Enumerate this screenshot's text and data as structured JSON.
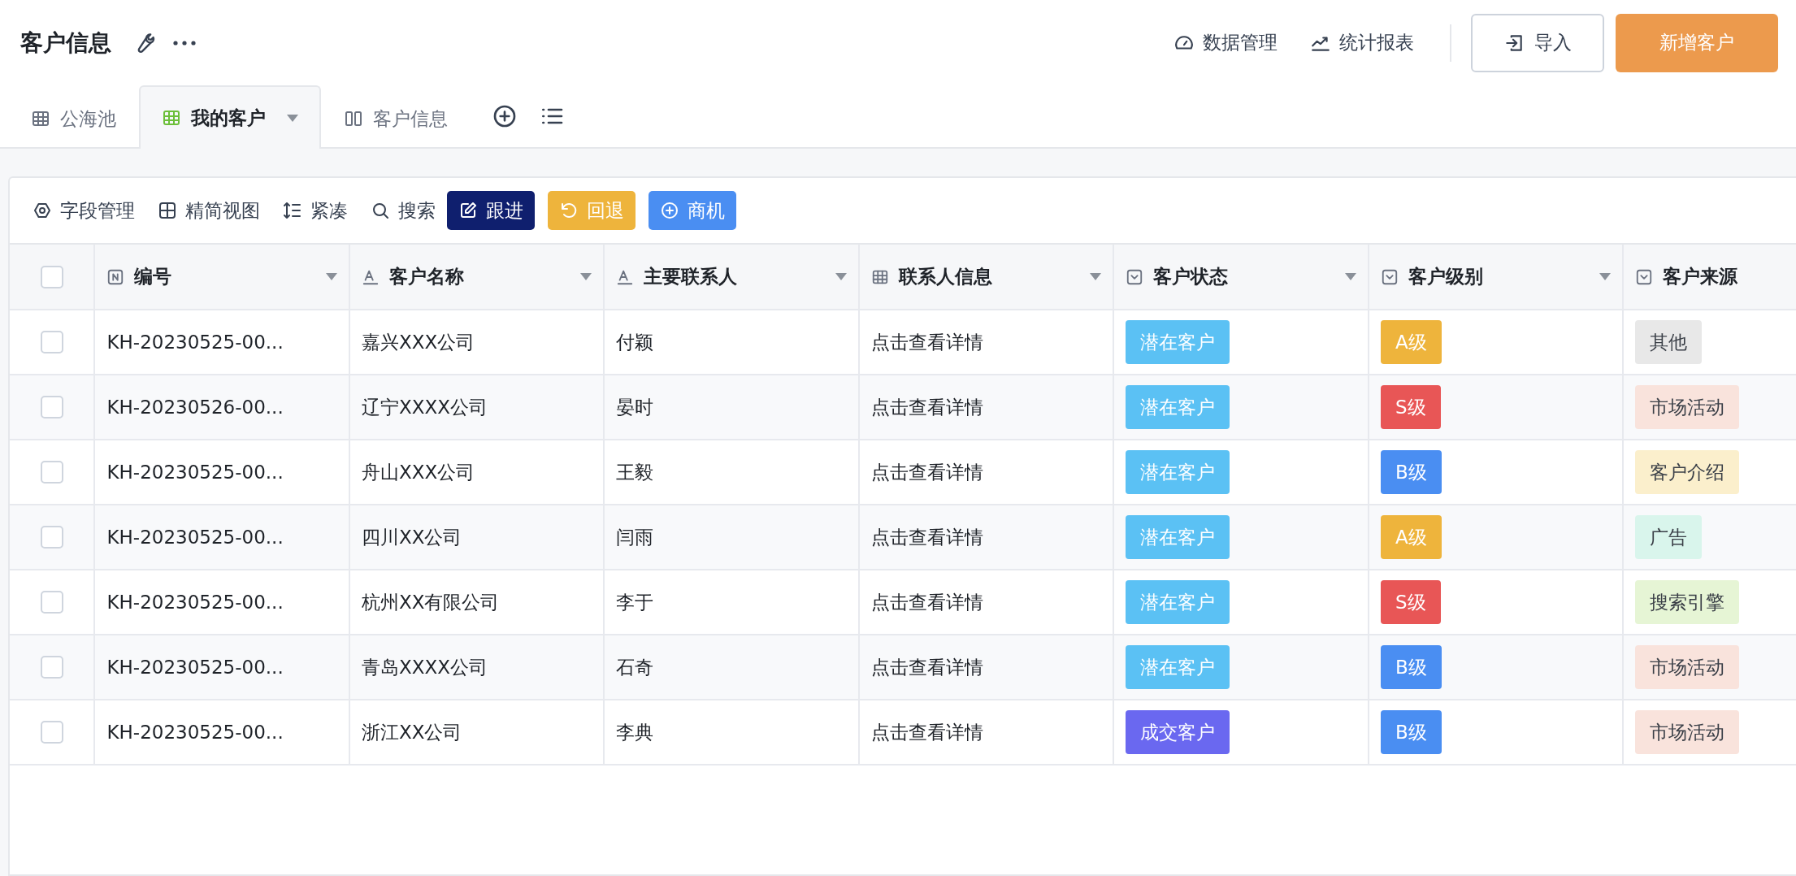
{
  "header": {
    "title": "客户信息",
    "links": [
      "数据管理",
      "统计报表"
    ],
    "import_button": "导入",
    "add_button": "新增客户"
  },
  "tabs": [
    {
      "label": "公海池",
      "kind": "table",
      "selected": false
    },
    {
      "label": "我的客户",
      "kind": "table",
      "selected": true
    },
    {
      "label": "客户信息",
      "kind": "board",
      "selected": false
    }
  ],
  "toolbar": [
    {
      "label": "字段管理",
      "kind": "plain"
    },
    {
      "label": "精简视图",
      "kind": "plain"
    },
    {
      "label": "紧凑",
      "kind": "plain"
    },
    {
      "label": "搜索",
      "kind": "plain"
    },
    {
      "label": "跟进",
      "kind": "action",
      "color": "#0f1f6e"
    },
    {
      "label": "回退",
      "kind": "action",
      "color": "#eeb43c"
    },
    {
      "label": "商机",
      "kind": "action",
      "color": "#4a8ef2"
    }
  ],
  "table": {
    "select_all_checked": false,
    "columns": [
      {
        "label": "编号",
        "kind": "number"
      },
      {
        "label": "客户名称",
        "kind": "text"
      },
      {
        "label": "主要联系人",
        "kind": "text"
      },
      {
        "label": "联系人信息",
        "kind": "table"
      },
      {
        "label": "客户状态",
        "kind": "select"
      },
      {
        "label": "客户级别",
        "kind": "select"
      },
      {
        "label": "客户来源",
        "kind": "select"
      }
    ],
    "rows": [
      {
        "checked": false,
        "id": "KH-20230525-00...",
        "name": "嘉兴XXX公司",
        "contact": "付颖",
        "info": "点击查看详情",
        "status": {
          "text": "潜在客户",
          "color": "#5bc1f4"
        },
        "level": {
          "text": "A级",
          "color": "#eeb43c"
        },
        "source": {
          "text": "其他",
          "color": "#e8e8e8"
        }
      },
      {
        "checked": false,
        "id": "KH-20230526-00...",
        "name": "辽宁XXXX公司",
        "contact": "晏时",
        "info": "点击查看详情",
        "status": {
          "text": "潜在客户",
          "color": "#5bc1f4"
        },
        "level": {
          "text": "S级",
          "color": "#e85656"
        },
        "source": {
          "text": "市场活动",
          "color": "#f9e3dc"
        }
      },
      {
        "checked": false,
        "id": "KH-20230525-00...",
        "name": "舟山XXX公司",
        "contact": "王毅",
        "info": "点击查看详情",
        "status": {
          "text": "潜在客户",
          "color": "#5bc1f4"
        },
        "level": {
          "text": "B级",
          "color": "#4a8ef2"
        },
        "source": {
          "text": "客户介绍",
          "color": "#fbefcc"
        }
      },
      {
        "checked": false,
        "id": "KH-20230525-00...",
        "name": "四川XX公司",
        "contact": "闫雨",
        "info": "点击查看详情",
        "status": {
          "text": "潜在客户",
          "color": "#5bc1f4"
        },
        "level": {
          "text": "A级",
          "color": "#eeb43c"
        },
        "source": {
          "text": "广告",
          "color": "#d9f5ec"
        }
      },
      {
        "checked": false,
        "id": "KH-20230525-00...",
        "name": "杭州XX有限公司",
        "contact": "李于",
        "info": "点击查看详情",
        "status": {
          "text": "潜在客户",
          "color": "#5bc1f4"
        },
        "level": {
          "text": "S级",
          "color": "#e85656"
        },
        "source": {
          "text": "搜索引擎",
          "color": "#e6f5d5"
        }
      },
      {
        "checked": false,
        "id": "KH-20230525-00...",
        "name": "青岛XXXX公司",
        "contact": "石奇",
        "info": "点击查看详情",
        "status": {
          "text": "潜在客户",
          "color": "#5bc1f4"
        },
        "level": {
          "text": "B级",
          "color": "#4a8ef2"
        },
        "source": {
          "text": "市场活动",
          "color": "#f9e3dc"
        }
      },
      {
        "checked": false,
        "id": "KH-20230525-00...",
        "name": "浙江XX公司",
        "contact": "李典",
        "info": "点击查看详情",
        "status": {
          "text": "成交客户",
          "color": "#6a68f0"
        },
        "level": {
          "text": "B级",
          "color": "#4a8ef2"
        },
        "source": {
          "text": "市场活动",
          "color": "#f9e3dc"
        }
      }
    ]
  }
}
